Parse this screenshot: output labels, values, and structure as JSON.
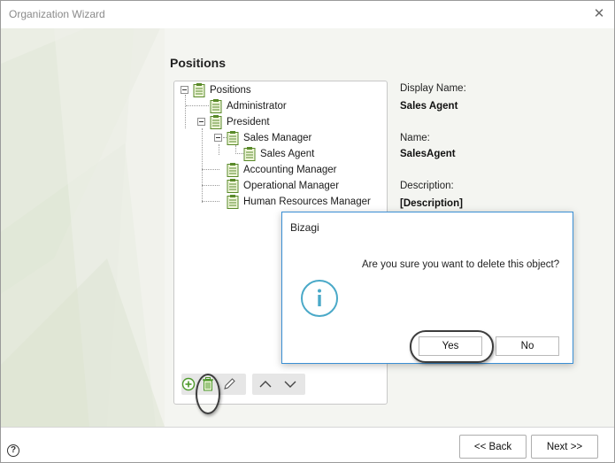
{
  "window": {
    "title": "Organization Wizard"
  },
  "page": {
    "heading": "Positions"
  },
  "tree": {
    "root": "Positions",
    "nodes": {
      "administrator": "Administrator",
      "president": "President",
      "sales_manager": "Sales Manager",
      "sales_agent": "Sales Agent",
      "accounting_manager": "Accounting Manager",
      "operational_manager": "Operational Manager",
      "hr_manager": "Human Resources Manager"
    }
  },
  "properties": {
    "display_name_label": "Display Name:",
    "display_name_value": "Sales Agent",
    "name_label": "Name:",
    "name_value": "SalesAgent",
    "description_label": "Description:",
    "description_value": "[Description]"
  },
  "dialog": {
    "title": "Bizagi",
    "message": "Are you sure you want to delete this object?",
    "yes_label": "Yes",
    "no_label": "No"
  },
  "footer": {
    "help": "?",
    "back_label": "<< Back",
    "next_label": "Next >>"
  },
  "colors": {
    "accent": "#3a8fd4",
    "info_icon": "#4aa9c8",
    "tree_icon": "#5a8a2a",
    "add_icon": "#4e9a2c"
  }
}
